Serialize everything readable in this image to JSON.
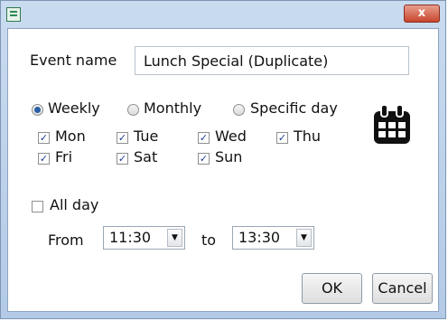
{
  "window": {
    "close_glyph": "x",
    "app_icon": "spreadsheet-icon"
  },
  "event_name": {
    "label": "Event name",
    "value": "Lunch Special (Duplicate)"
  },
  "recurrence": {
    "options": [
      "Weekly",
      "Monthly",
      "Specific day"
    ],
    "selected": "Weekly"
  },
  "days": [
    {
      "label": "Mon",
      "checked": true
    },
    {
      "label": "Tue",
      "checked": true
    },
    {
      "label": "Wed",
      "checked": true
    },
    {
      "label": "Thu",
      "checked": true
    },
    {
      "label": "Fri",
      "checked": true
    },
    {
      "label": "Sat",
      "checked": true
    },
    {
      "label": "Sun",
      "checked": true
    }
  ],
  "all_day": {
    "label": "All day",
    "checked": false
  },
  "time": {
    "from_label": "From",
    "from_value": "11:30",
    "to_label": "to",
    "to_value": "13:30"
  },
  "buttons": {
    "ok": "OK",
    "cancel": "Cancel"
  },
  "calendar_icon": "calendar-icon"
}
